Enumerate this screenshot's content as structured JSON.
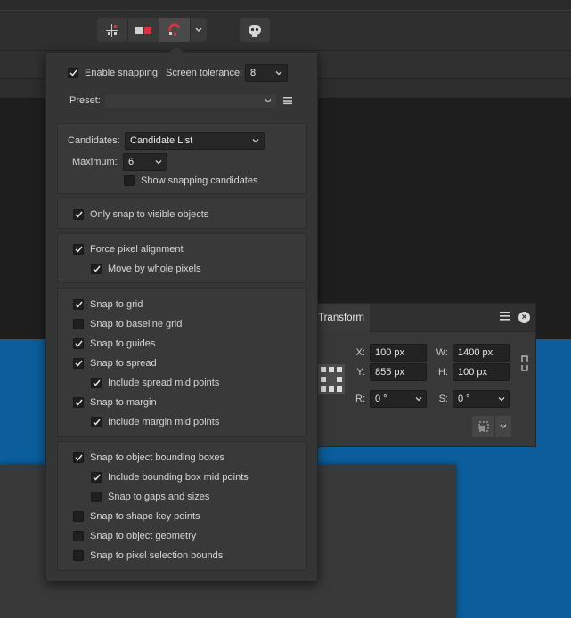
{
  "toolbar": {
    "icons": [
      "snap-grid-icon",
      "snap-align-icon",
      "snapping-magnet-icon",
      "chevron-down-icon",
      "assistant-robot-icon"
    ],
    "accent": "#e0303a"
  },
  "snapping": {
    "enable_label": "Enable snapping",
    "enable_checked": true,
    "tolerance_label": "Screen tolerance:",
    "tolerance_value": "8",
    "preset_label": "Preset:",
    "preset_value": "",
    "candidates_label": "Candidates:",
    "candidates_value": "Candidate List",
    "maximum_label": "Maximum:",
    "maximum_value": "6",
    "show_candidates_label": "Show snapping candidates",
    "visible_only_label": "Only snap to visible objects",
    "force_pixel_label": "Force pixel alignment",
    "whole_pixels_label": "Move by whole pixels",
    "grid_label": "Snap to grid",
    "baseline_label": "Snap to baseline grid",
    "guides_label": "Snap to guides",
    "spread_label": "Snap to spread",
    "spread_mid_label": "Include spread mid points",
    "margin_label": "Snap to margin",
    "margin_mid_label": "Include margin mid points",
    "bbox_label": "Snap to object bounding boxes",
    "bbox_mid_label": "Include bounding box mid points",
    "gaps_label": "Snap to gaps and sizes",
    "shape_key_label": "Snap to shape key points",
    "geometry_label": "Snap to object geometry",
    "pixel_sel_label": "Snap to pixel selection bounds"
  },
  "transform": {
    "tab_label": "Transform",
    "x_label": "X:",
    "x_value": "100 px",
    "y_label": "Y:",
    "y_value": "855 px",
    "w_label": "W:",
    "w_value": "1400 px",
    "h_label": "H:",
    "h_value": "100 px",
    "r_label": "R:",
    "r_value": "0 °",
    "s_label": "S:",
    "s_value": "0 °"
  }
}
